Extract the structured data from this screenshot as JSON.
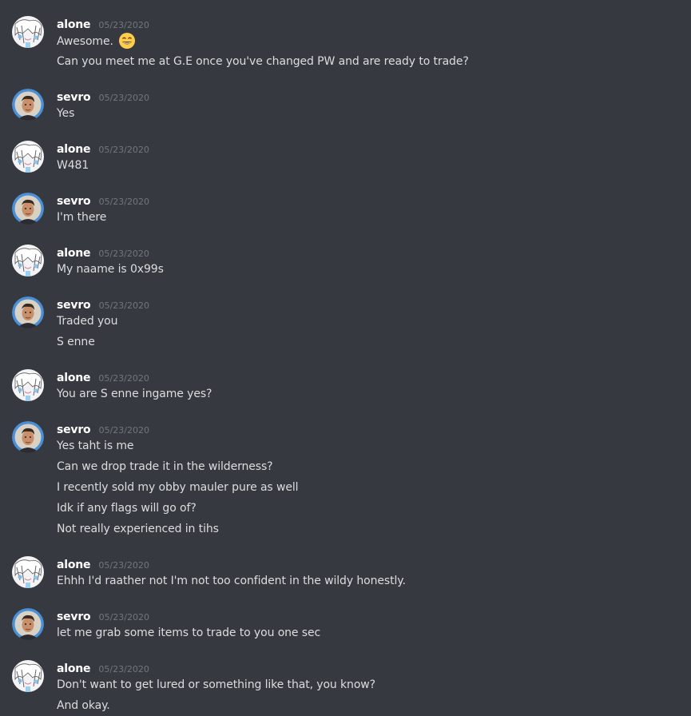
{
  "users": {
    "alone": {
      "name": "alone",
      "avatar_icon": "anime-avatar-icon"
    },
    "sevro": {
      "name": "sevro",
      "avatar_icon": "portrait-avatar-icon",
      "ring_color": "#4a90d9"
    }
  },
  "emoji": {
    "grin": "grinning-face-emoji-icon"
  },
  "messages": [
    {
      "author": "alone",
      "timestamp": "05/23/2020",
      "lines": [
        "Awesome.",
        "Can you meet me at G.E once you've changed PW and are ready to trade?"
      ]
    },
    {
      "author": "sevro",
      "timestamp": "05/23/2020",
      "lines": [
        "Yes"
      ]
    },
    {
      "author": "alone",
      "timestamp": "05/23/2020",
      "lines": [
        "W481"
      ]
    },
    {
      "author": "sevro",
      "timestamp": "05/23/2020",
      "lines": [
        "I'm there"
      ]
    },
    {
      "author": "alone",
      "timestamp": "05/23/2020",
      "lines": [
        "My naame is 0x99s"
      ]
    },
    {
      "author": "sevro",
      "timestamp": "05/23/2020",
      "lines": [
        "Traded you",
        "S enne"
      ]
    },
    {
      "author": "alone",
      "timestamp": "05/23/2020",
      "lines": [
        "You are S enne ingame yes?"
      ]
    },
    {
      "author": "sevro",
      "timestamp": "05/23/2020",
      "lines": [
        "Yes taht is me",
        "Can we drop trade it in the wilderness?",
        "I recently sold my obby mauler pure as well",
        "Idk if any flags will go of?",
        "Not really experienced in tihs"
      ]
    },
    {
      "author": "alone",
      "timestamp": "05/23/2020",
      "lines": [
        "Ehhh I'd raather not I'm not too confident in the wildy honestly."
      ]
    },
    {
      "author": "sevro",
      "timestamp": "05/23/2020",
      "lines": [
        "let me grab some items to trade to you one sec"
      ]
    },
    {
      "author": "alone",
      "timestamp": "05/23/2020",
      "lines": [
        "Don't want to get lured or something like that, you know?",
        "And okay."
      ]
    }
  ]
}
